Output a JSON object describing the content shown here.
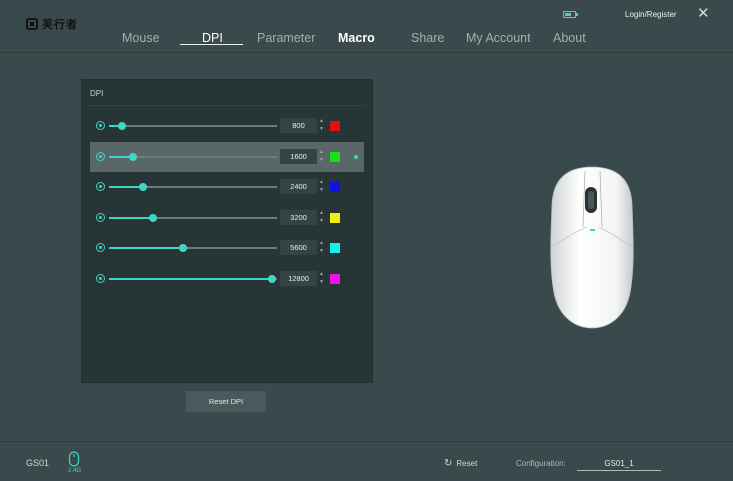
{
  "app": {
    "logo_text": "芙行者"
  },
  "nav": {
    "tabs": [
      {
        "label": "Mouse",
        "active": false
      },
      {
        "label": "DPI",
        "active": true
      },
      {
        "label": "Parameter",
        "active": false
      },
      {
        "label": "Macro",
        "active": false
      },
      {
        "label": "Share",
        "active": false
      },
      {
        "label": "My Account",
        "active": false
      },
      {
        "label": "About",
        "active": false
      }
    ]
  },
  "header": {
    "login_label": "Login/Register",
    "battery_icon": "battery-icon",
    "close_icon": "close-icon",
    "battery_level": 0.7
  },
  "dpi_panel": {
    "title": "DPI",
    "levels": [
      {
        "value": "800",
        "fill": 0.08,
        "color": "#e01010",
        "selected": false
      },
      {
        "value": "1600",
        "fill": 0.14,
        "color": "#18e018",
        "selected": true
      },
      {
        "value": "2400",
        "fill": 0.2,
        "color": "#1010e0",
        "selected": false
      },
      {
        "value": "3200",
        "fill": 0.26,
        "color": "#f0f010",
        "selected": false
      },
      {
        "value": "5600",
        "fill": 0.44,
        "color": "#10f0f0",
        "selected": false
      },
      {
        "value": "12800",
        "fill": 0.97,
        "color": "#f010f0",
        "selected": false
      }
    ],
    "reset_label": "Reset DPI"
  },
  "footer": {
    "device_name": "GS01",
    "connection": "2.4G",
    "reset_label": "Reset",
    "config_label": "Configuration:",
    "config_value": "GS01_1"
  },
  "colors": {
    "accent": "#3fd6c6",
    "background": "#3a4a4c"
  }
}
